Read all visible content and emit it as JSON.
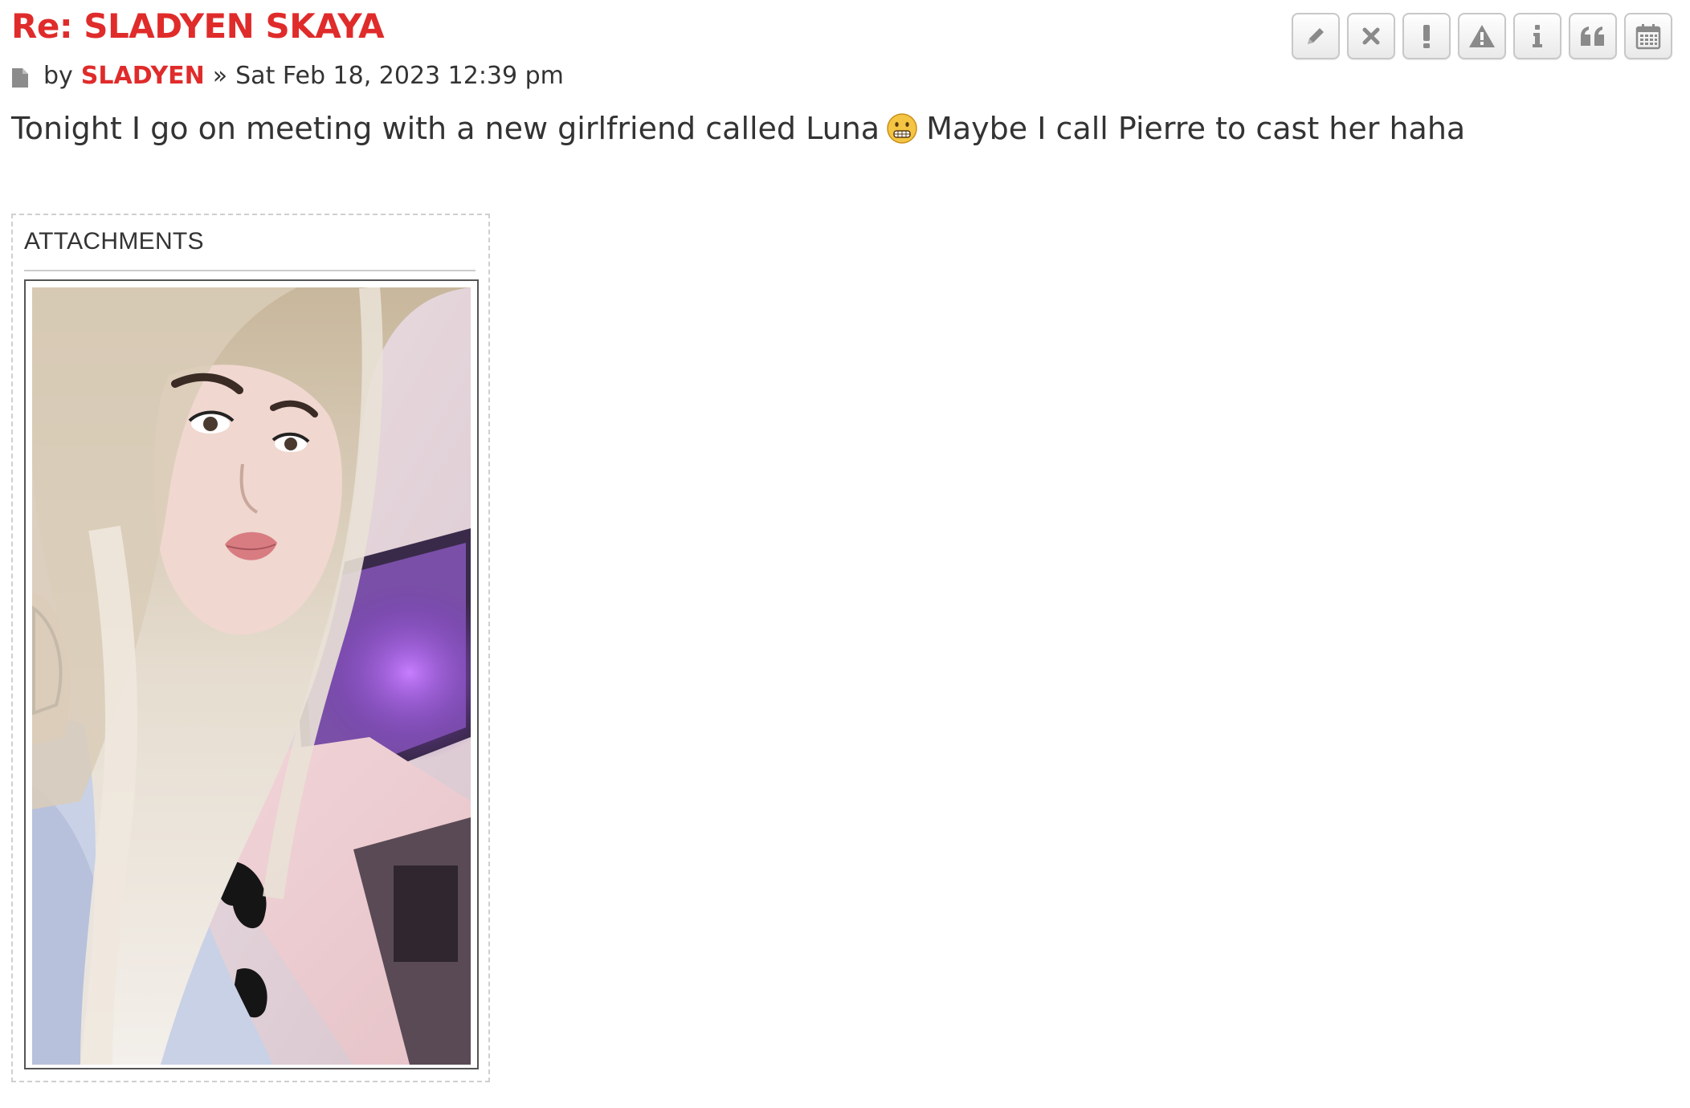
{
  "post": {
    "title": "Re: SLADYEN SKAYA",
    "by_label": "by",
    "author": "SLADYEN",
    "separator": "»",
    "datetime": "Sat Feb 18, 2023 12:39 pm",
    "content_before_emoji": "Tonight I go on meeting with a new girlfriend called Luna",
    "emoji": "grimacing-face-emoji",
    "content_after_emoji": "Maybe I call Pierre to cast her haha"
  },
  "toolbar": {
    "buttons": [
      {
        "icon": "pencil-icon"
      },
      {
        "icon": "close-icon"
      },
      {
        "icon": "exclamation-icon"
      },
      {
        "icon": "warning-icon"
      },
      {
        "icon": "info-icon"
      },
      {
        "icon": "quote-icon"
      },
      {
        "icon": "calendar-icon"
      }
    ]
  },
  "attachments": {
    "heading": "ATTACHMENTS",
    "items": [
      {
        "type": "image",
        "description_icon": "photo-thumbnail"
      }
    ]
  },
  "colors": {
    "accent": "#e02b2b",
    "text": "#333333",
    "button_icon": "#8a8a8a"
  }
}
